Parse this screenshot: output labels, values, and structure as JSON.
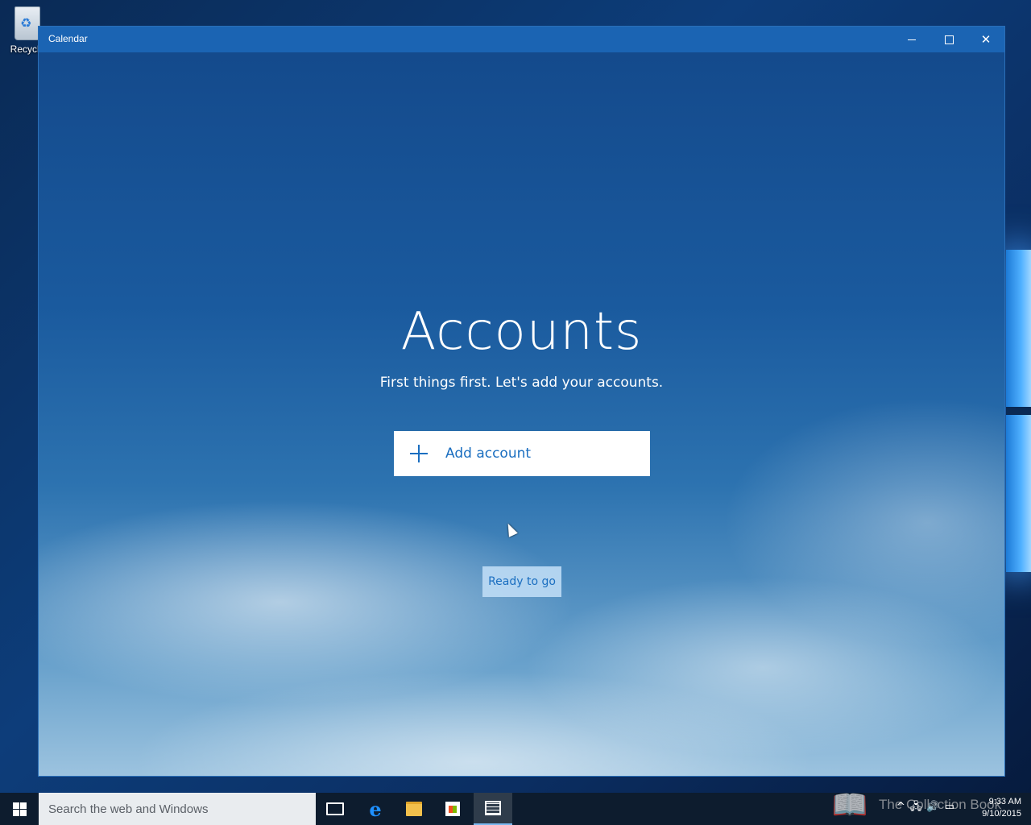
{
  "desktop": {
    "recycle_bin_label": "Recycle"
  },
  "window": {
    "title": "Calendar"
  },
  "accounts": {
    "heading": "Accounts",
    "subheading": "First things first. Let's add your accounts.",
    "add_account_label": "Add account",
    "status_tooltip": "Ready to go"
  },
  "taskbar": {
    "search_placeholder": "Search the web and Windows",
    "watermark": "The Collection Book",
    "clock_time": "9:33 AM",
    "clock_date": "9/10/2015",
    "icons": [
      "start-icon",
      "task-view-icon",
      "edge-icon",
      "file-explorer-icon",
      "store-icon",
      "calendar-icon"
    ]
  },
  "colors": {
    "titlebar": "#1b64b3",
    "accent": "#1a6ec0",
    "taskbar": "#0d1c2e"
  }
}
